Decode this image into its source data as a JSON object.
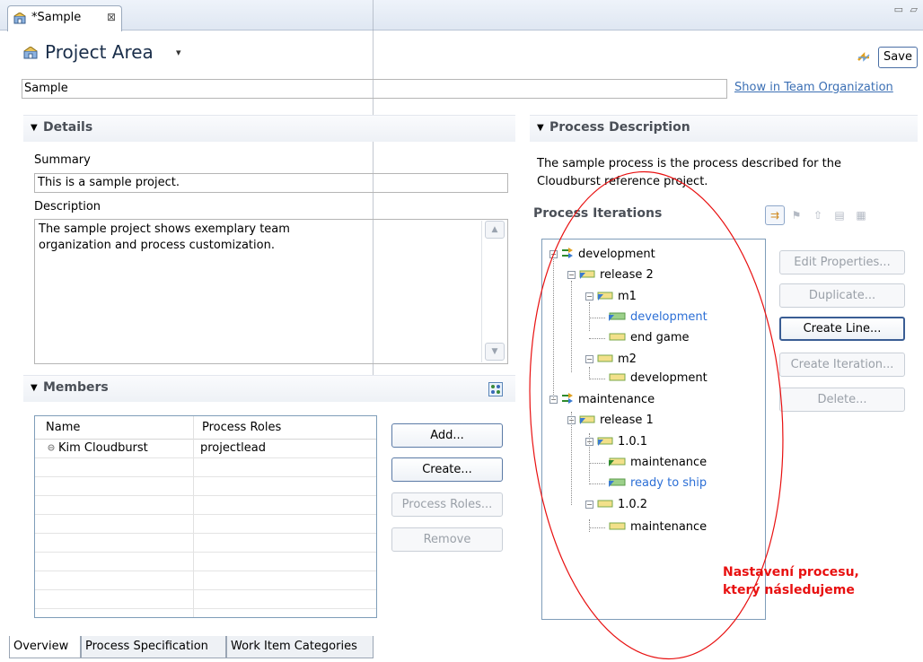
{
  "editor_tab": {
    "title": "*Sample",
    "close": "⊠",
    "window_controls": "▭ ▱"
  },
  "header": {
    "title": "Project Area",
    "dropdown": "▾",
    "save_label": "Save"
  },
  "name_field": {
    "value": "Sample"
  },
  "show_link": "Show in Team Organization",
  "details": {
    "header": "Details",
    "summary_label": "Summary",
    "summary_value": "This is a sample project.",
    "description_label": "Description",
    "description_line1": "The sample project shows exemplary team",
    "description_line2": "organization and process customization."
  },
  "members": {
    "header": "Members",
    "columns": [
      "Name",
      "Process Roles"
    ],
    "rows": [
      {
        "name": "Kim Cloudburst",
        "roles": "projectlead"
      }
    ],
    "buttons": {
      "add": "Add...",
      "create": "Create...",
      "process_roles": "Process Roles...",
      "remove": "Remove"
    }
  },
  "process_description": {
    "header": "Process Description",
    "line1": "The sample process is the process described for the",
    "line2": "Cloudburst reference project."
  },
  "process_iterations": {
    "header": "Process Iterations",
    "tree": {
      "n1": "development",
      "n2": "release 2",
      "n3": "m1",
      "n4": "development",
      "n5": "end game",
      "n6": "m2",
      "n7": "development",
      "n8": "maintenance",
      "n9": "release 1",
      "n10": "1.0.1",
      "n11": "maintenance",
      "n12": "ready to ship",
      "n13": "1.0.2",
      "n14": "maintenance"
    },
    "buttons": {
      "edit_properties": "Edit Properties...",
      "duplicate": "Duplicate...",
      "create_line": "Create Line...",
      "create_iteration": "Create Iteration...",
      "delete": "Delete..."
    }
  },
  "bottom_tabs": [
    "Overview",
    "Process Specification",
    "Work Item Categories"
  ],
  "annotation": {
    "line1": "Nastavení procesu,",
    "line2": "který následujeme",
    "color": "#e81010"
  }
}
